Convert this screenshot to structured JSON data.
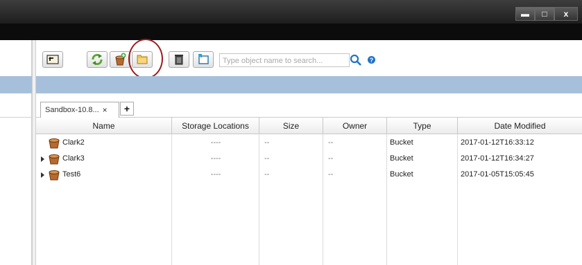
{
  "window": {
    "minimize": "▬",
    "maximize": "□",
    "close": "x"
  },
  "toolbar": {
    "icons": [
      "folder-up-icon",
      "refresh-icon",
      "add-bucket-icon",
      "new-folder-icon",
      "delete-icon",
      "new-item-icon"
    ],
    "search_placeholder": "Type object name to search...",
    "help": "?"
  },
  "tabs": [
    {
      "label": "Sandbox-10.8...",
      "close": "×"
    }
  ],
  "tab_add": "+",
  "table": {
    "columns": [
      "Name",
      "Storage Locations",
      "Size",
      "Owner",
      "Type",
      "Date Modified"
    ],
    "rows": [
      {
        "expandable": false,
        "name": "Clark2",
        "storage": "----",
        "size": "--",
        "owner": "--",
        "type": "Bucket",
        "modified": "2017-01-12T16:33:12"
      },
      {
        "expandable": true,
        "name": "Clark3",
        "storage": "----",
        "size": "--",
        "owner": "--",
        "type": "Bucket",
        "modified": "2017-01-12T16:34:27"
      },
      {
        "expandable": true,
        "name": "Test6",
        "storage": "----",
        "size": "--",
        "owner": "--",
        "type": "Bucket",
        "modified": "2017-01-05T15:05:45"
      }
    ]
  },
  "colors": {
    "accent_band": "#a6c0dc",
    "highlight_ring": "#9b1b1b",
    "titlebar": "#2a2a2a"
  }
}
